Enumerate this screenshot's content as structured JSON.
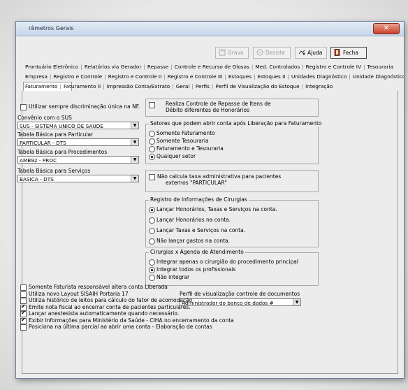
{
  "window": {
    "title": "râmetros Gerais",
    "close_label": "✕"
  },
  "toolbar": {
    "grava": "Grava",
    "desiste": "Desiste",
    "ajuda": "Ajuda",
    "fecha": "Fecha"
  },
  "tabs_row1": [
    "Prontuário Eletrônico",
    "Relatórios via Gerador",
    "Repasse",
    "Controle e Recurso de Glosas",
    "Med. Controlados",
    "Registro e Controle IV",
    "Tesouraria"
  ],
  "tabs_row2": [
    "Empresa",
    "Registro e Controle",
    "Registro e Controle II",
    "Registro e Controle III",
    "Estoques",
    "Estoques II",
    "Unidades Diagnóstico",
    "Unidade Diagnóstico II"
  ],
  "tabs_row3": [
    "Faturamento",
    "Faturamento II",
    "Impressão Conta/Extrato",
    "Geral",
    "Perfis",
    "Perfil de Visualização do Estoque",
    "Integração"
  ],
  "left": {
    "chk_discriminacao": "Utilizar sempre discriminação única na NF.",
    "convenio_label": "Convênio com o SUS",
    "convenio_value": "SUS - SISTEMA UNICO DE SAUDE",
    "tabela_particular_label": "Tabela Básica para Particular",
    "tabela_particular_value": "PARTICULAR - DTS",
    "tabela_proc_label": "Tabela Básica para Procedimentos",
    "tabela_proc_value": "AMB92 - PROC",
    "tabela_serv_label": "Tabela Básica para Serviços",
    "tabela_serv_value": "BASICA - DTS"
  },
  "right": {
    "chk_repasse_l1": "Realiza Controle de Repasse de Itens de",
    "chk_repasse_l2": "Débito diferentes de Honorários",
    "setores_title": "Setores que podem abrir conta após Liberação para Faturamento",
    "setores_opts": [
      "Somente Faturamento",
      "Somente Tesouraria",
      "Faturamento e Tesouraria",
      "Qualquer setor"
    ],
    "chk_taxa_l1": "Não calcula taxa administrativa para pacientes",
    "chk_taxa_l2": "externos \"PARTICULAR\"",
    "cirurgias_title": "Registro de Informações de Cirurgias",
    "cirurgias_opts": [
      "Lançar Honorários, Taxas e Serviços na conta.",
      "Lançar Honorários na conta.",
      "Lançar Taxas e Serviços na conta.",
      "Não lançar gastos na conta."
    ],
    "agenda_title": "Cirurgias x Agenda de Atendimento",
    "agenda_opts": [
      "Integrar apenas o cirurgião do procedimento principal",
      "Integrar todos os profissionais",
      "Não integrar"
    ],
    "perfil_label": "Perfil de visualização controle de documentos",
    "perfil_value": "Administrador do banco de dados #"
  },
  "bottom_checks": [
    "Somente Faturista responsável altera conta Liberada",
    "Utiliza novo Layout SISAIH Portaria 17",
    "Utiliza histórico de leitos para cálculo do fator de acomodação",
    "Emite nota fiscal ao encerrar conta de pacientes particulares.",
    "Lançar anestesista automaticamente quando necessário.",
    "Exibir Informações para Ministério da Saúde - CIHA no encerramento da conta",
    "Posiciona na última parcial ao abrir uma conta - Elaboração de contas"
  ],
  "colors": {
    "accent_close": "#c9412a",
    "titlebar": "#c6d5e8"
  }
}
